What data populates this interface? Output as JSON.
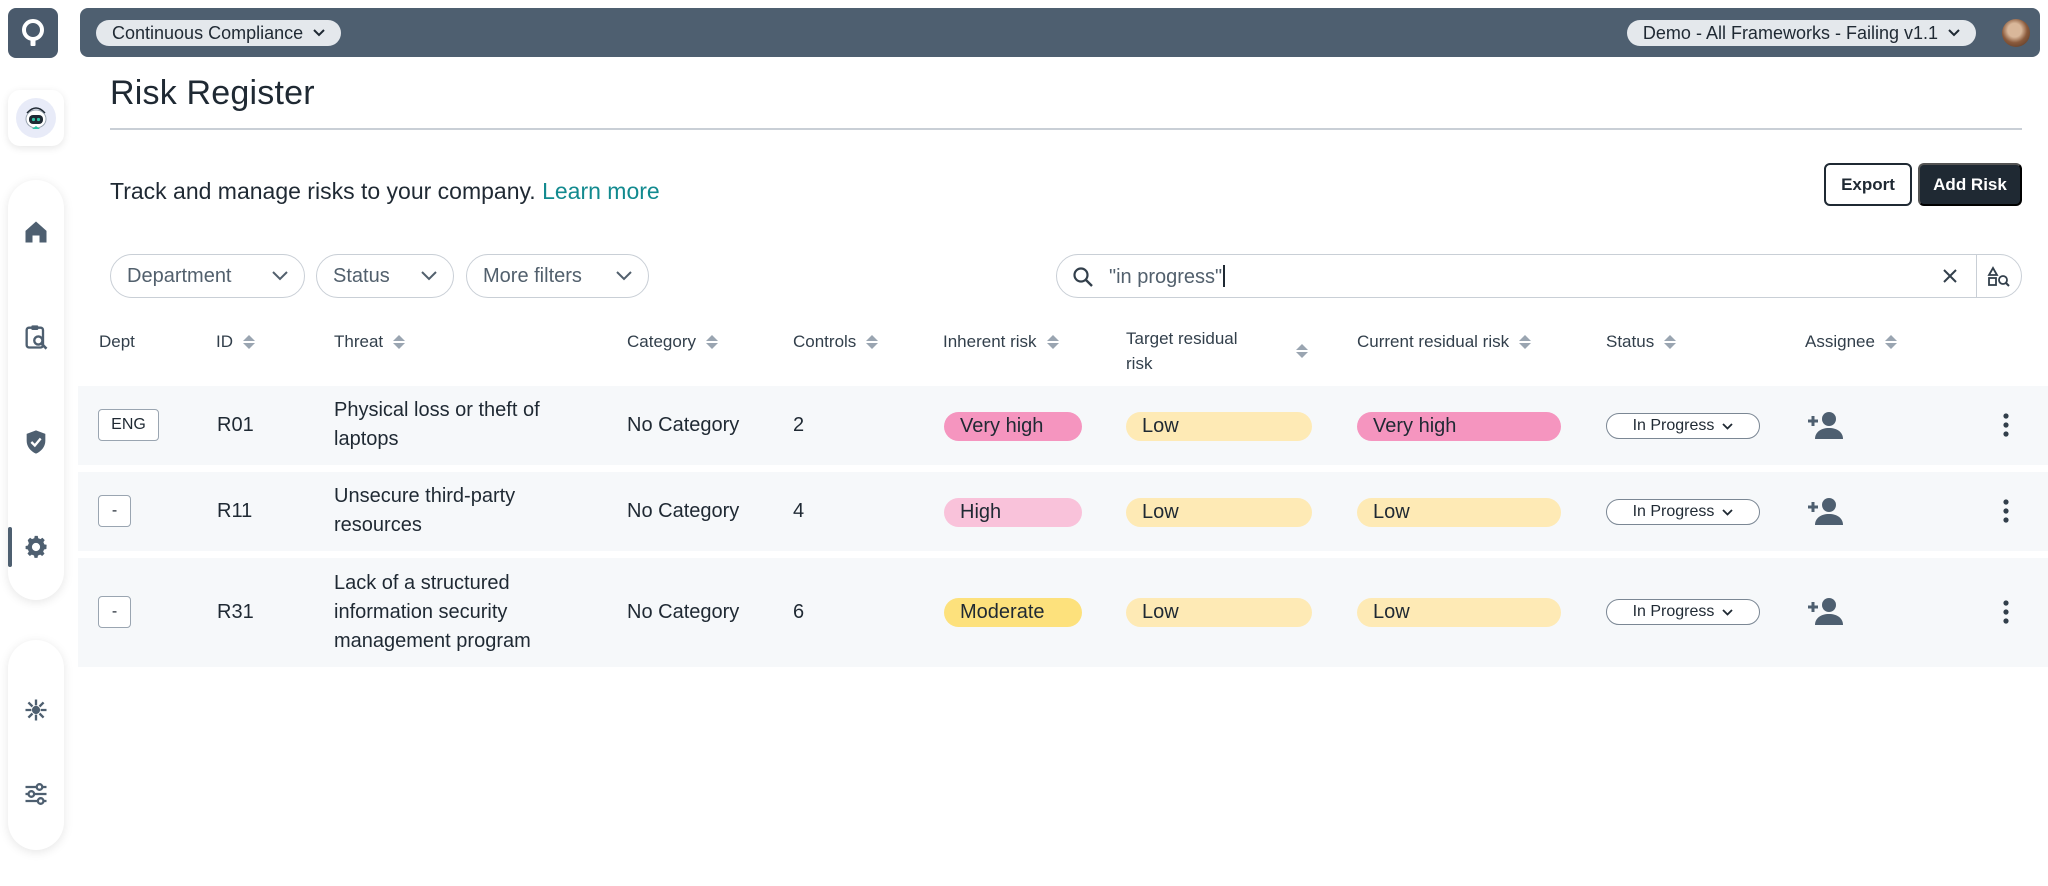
{
  "colors": {
    "topbar": "#4e5f70",
    "very_high": "#f595bf",
    "high": "#f9c2da",
    "moderate": "#fde17c",
    "low": "#feeab5",
    "link": "#128a8f",
    "primary_button": "#1f2933"
  },
  "topbar": {
    "workspace_select": "Continuous Compliance",
    "framework_select": "Demo - All Frameworks - Failing v1.1"
  },
  "sidebar": {
    "items": [
      {
        "icon": "home-icon"
      },
      {
        "icon": "clipboard-search-icon"
      },
      {
        "icon": "shield-check-icon"
      },
      {
        "icon": "gear-icon",
        "active": true
      },
      {
        "icon": "integrations-icon"
      },
      {
        "icon": "sliders-icon"
      }
    ]
  },
  "header": {
    "title": "Risk Register",
    "description": "Track and manage risks to your company.",
    "learn_more": "Learn more",
    "export_label": "Export",
    "add_label": "Add Risk"
  },
  "filters": {
    "department": "Department",
    "status": "Status",
    "more": "More filters"
  },
  "search": {
    "value": "\"in progress\""
  },
  "table": {
    "columns": {
      "dept": "Dept",
      "id": "ID",
      "threat": "Threat",
      "category": "Category",
      "controls": "Controls",
      "inherent": "Inherent risk",
      "target_1": "Target residual",
      "target_2": "risk",
      "current": "Current residual risk",
      "status": "Status",
      "assignee": "Assignee"
    },
    "rows": [
      {
        "dept": "ENG",
        "id": "R01",
        "threat_lines": [
          "Physical loss or theft of",
          "laptops"
        ],
        "category": "No Category",
        "controls": "2",
        "inherent": "Very high",
        "target": "Low",
        "current": "Very high",
        "status": "In Progress"
      },
      {
        "dept": "-",
        "id": "R11",
        "threat_lines": [
          "Unsecure third-party",
          "resources"
        ],
        "category": "No Category",
        "controls": "4",
        "inherent": "High",
        "target": "Low",
        "current": "Low",
        "status": "In Progress"
      },
      {
        "dept": "-",
        "id": "R31",
        "threat_lines": [
          "Lack of a structured",
          "information security",
          "management program"
        ],
        "category": "No Category",
        "controls": "6",
        "inherent": "Moderate",
        "target": "Low",
        "current": "Low",
        "status": "In Progress"
      }
    ]
  }
}
